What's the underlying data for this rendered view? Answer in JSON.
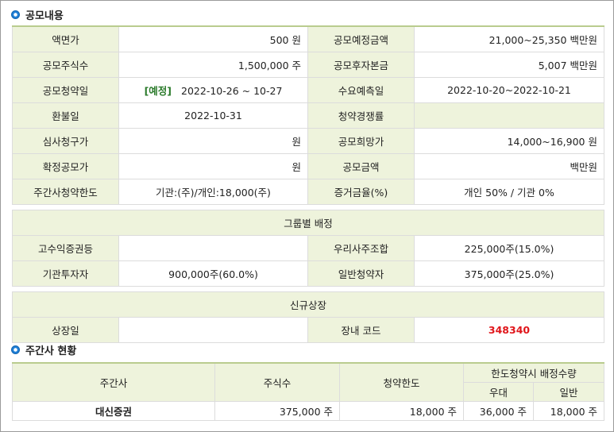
{
  "offering_section": {
    "title": "공모내용"
  },
  "offering": {
    "rows": [
      [
        {
          "label": "액면가",
          "value": "500 원"
        },
        {
          "label": "공모예정금액",
          "value": "21,000~25,350 백만원"
        }
      ],
      [
        {
          "label": "공모주식수",
          "value": "1,500,000 주"
        },
        {
          "label": "공모후자본금",
          "value": "5,007 백만원"
        }
      ],
      [
        {
          "label": "공모청약일",
          "badge": "[예정]",
          "value": "2022-10-26 ~ 10-27"
        },
        {
          "label": "수요예측일",
          "value": "2022-10-20~2022-10-21"
        }
      ],
      [
        {
          "label": "환불일",
          "value": "2022-10-31"
        },
        {
          "label": "청약경쟁률",
          "value": ""
        }
      ],
      [
        {
          "label": "심사청구가",
          "value": "원"
        },
        {
          "label": "공모희망가",
          "value": "14,000~16,900 원"
        }
      ],
      [
        {
          "label": "확정공모가",
          "value": "원"
        },
        {
          "label": "공모금액",
          "value": "백만원"
        }
      ],
      [
        {
          "label": "주간사청약한도",
          "value": "기관:(주)/개인:18,000(주)"
        },
        {
          "label": "증거금율(%)",
          "value": "개인 50% / 기관 0%"
        }
      ]
    ]
  },
  "group_allocation": {
    "title": "그룹별 배정",
    "rows": [
      [
        {
          "label": "고수익증권등",
          "value": ""
        },
        {
          "label": "우리사주조합",
          "value": "225,000주(15.0%)"
        }
      ],
      [
        {
          "label": "기관투자자",
          "value": "900,000주(60.0%)"
        },
        {
          "label": "일반청약자",
          "value": "375,000주(25.0%)"
        }
      ]
    ]
  },
  "new_listing": {
    "title": "신규상장",
    "listing_date_label": "상장일",
    "listing_date": "",
    "code_label": "장내 코드",
    "code": "348340"
  },
  "underwriter_section": {
    "title": "주간사 현황"
  },
  "underwriter_table": {
    "headers": {
      "underwriter": "주간사",
      "shares": "주식수",
      "limit": "청약한도",
      "allocation_group": "한도청약시 배정수량",
      "preferred": "우대",
      "general": "일반"
    },
    "rows": [
      {
        "underwriter": "대신증권",
        "shares": "375,000 주",
        "limit": "18,000 주",
        "preferred": "36,000 주",
        "general": "18,000 주"
      }
    ]
  },
  "colors": {
    "label_bg": "#eef3dc",
    "header_line": "#b9cc8e",
    "code": "#e0161b",
    "badge": "#2a7a2a",
    "bullet": "#1f7fd6"
  }
}
